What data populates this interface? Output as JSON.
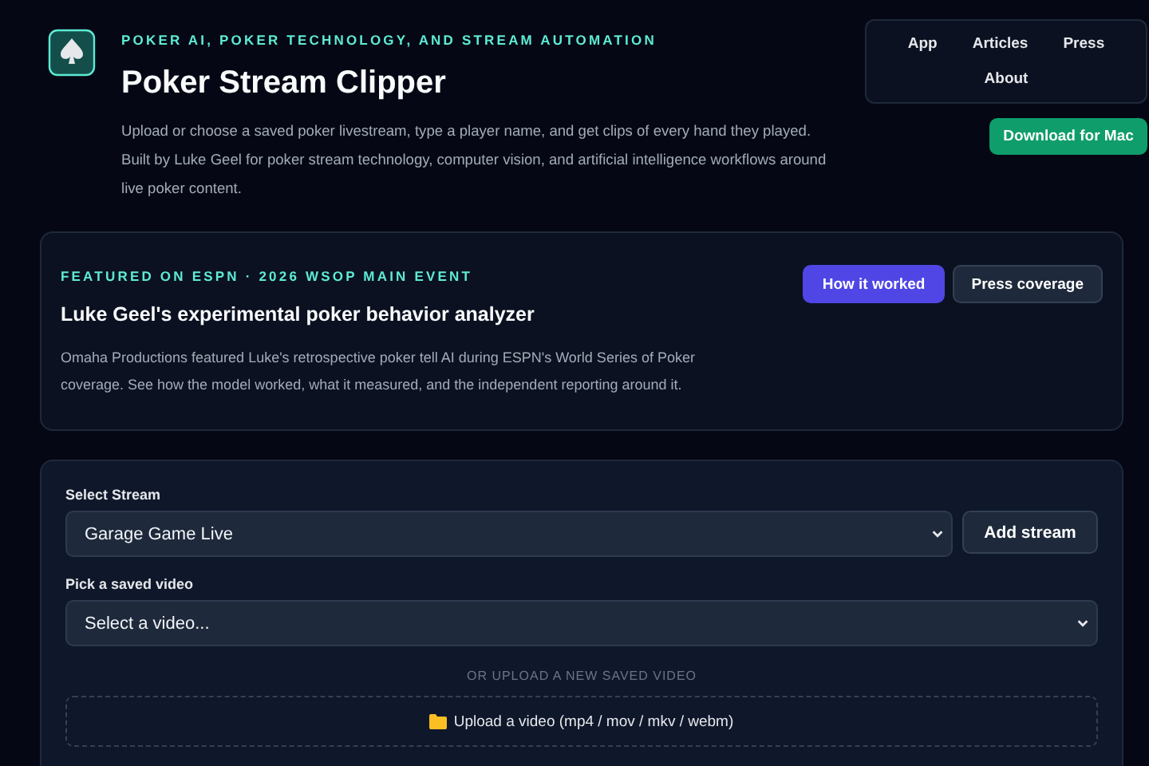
{
  "header": {
    "tagline": "POKER AI, POKER TECHNOLOGY, AND STREAM AUTOMATION",
    "title": "Poker Stream Clipper",
    "description": "Upload or choose a saved poker livestream, type a player name, and get clips of every hand they played. Built by Luke Geel for poker stream technology, computer vision, and artificial intelligence workflows around live poker content."
  },
  "nav": {
    "links": [
      "App",
      "Articles",
      "Press",
      "About"
    ],
    "download": "Download for Mac"
  },
  "featured": {
    "eyebrow": "FEATURED ON ESPN · 2026 WSOP MAIN EVENT",
    "title": "Luke Geel's experimental poker behavior analyzer",
    "text": "Omaha Productions featured Luke's retrospective poker tell AI during ESPN's World Series of Poker coverage. See how the model worked, what it measured, and the independent reporting around it.",
    "buttons": [
      {
        "label": "How it worked",
        "kind": "primary"
      },
      {
        "label": "Press coverage",
        "kind": "secondary"
      }
    ]
  },
  "form": {
    "stream_label": "Select Stream",
    "stream_value": "Garage Game Live",
    "add_stream": "Add stream",
    "video_label": "Pick a saved video",
    "video_value": "Select a video...",
    "divider": "OR UPLOAD A NEW SAVED VIDEO",
    "upload": "Upload a video (mp4 / mov / mkv / webm)"
  }
}
